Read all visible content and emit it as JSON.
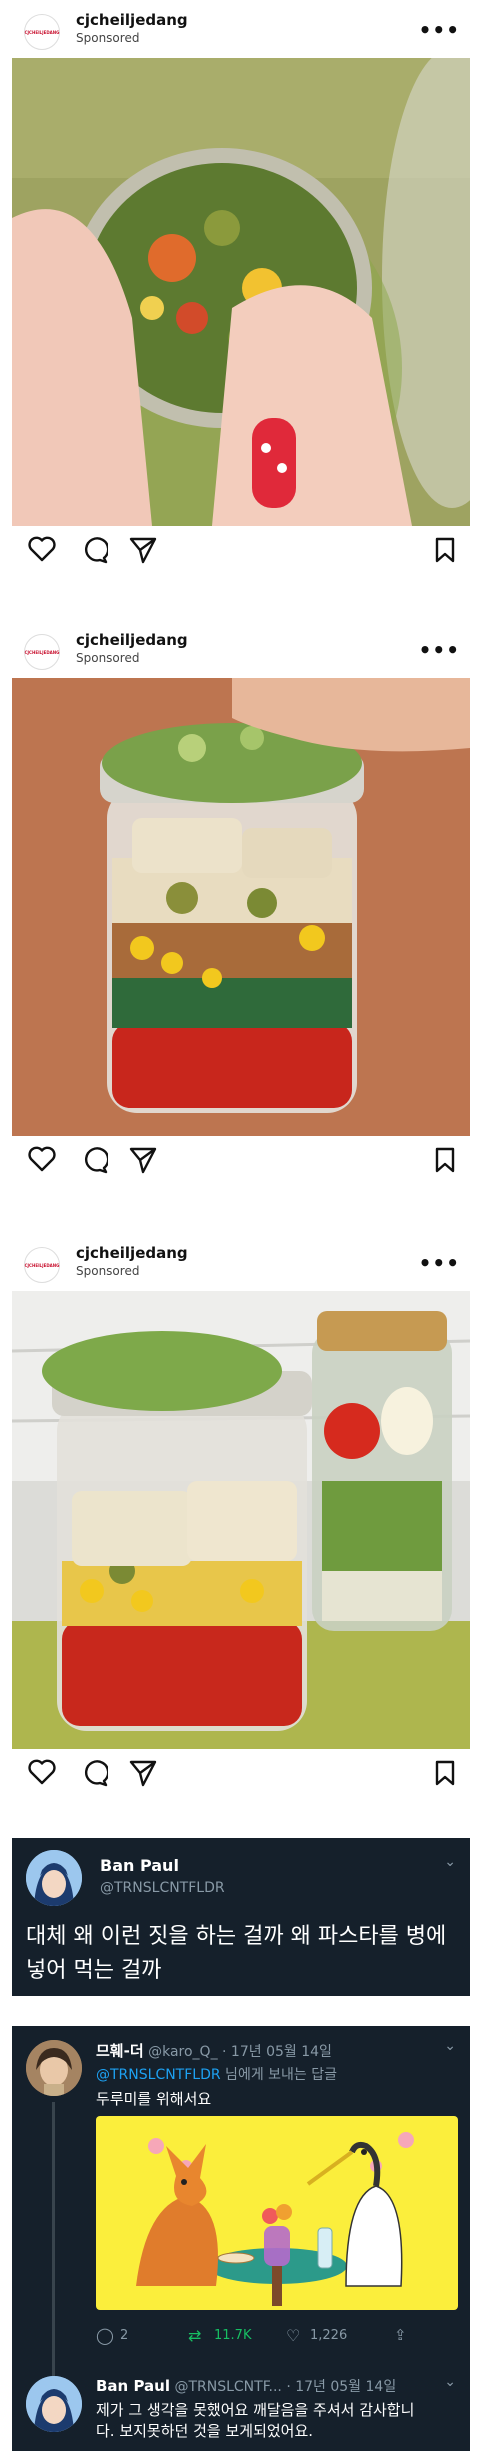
{
  "posts": [
    {
      "username": "cjcheiljedang",
      "sponsored": "Sponsored",
      "logo_text": "CJCHEILJEDANG"
    },
    {
      "username": "cjcheiljedang",
      "sponsored": "Sponsored",
      "logo_text": "CJCHEILJEDANG"
    },
    {
      "username": "cjcheiljedang",
      "sponsored": "Sponsored",
      "logo_text": "CJCHEILJEDANG"
    }
  ],
  "tweet1": {
    "name": "Ban Paul",
    "handle": "@TRNSLCNTFLDR",
    "text": "대체 왜 이런 짓을 하는 걸까 왜 파스타를 병에 넣어 먹는 걸까"
  },
  "tweet2": {
    "name": "므훼-더",
    "handle": "@karo_Q_",
    "date": "· 17년 05월 14일",
    "mention": "@TRNSLCNTFLDR",
    "reply_suffix": " 님에게 보내는 답글",
    "text": "두루미를 위해서요",
    "replies": "2",
    "retweets": "11.7K",
    "likes": "1,226"
  },
  "tweet3": {
    "name": "Ban Paul",
    "handle": "@TRNSLCNTF...",
    "date": "· 17년 05월 14일",
    "text": "제가 그 생각을 못했어요 깨달음을 주셔서 감사합니다. 보지못하던 것을 보게되었어요."
  },
  "colors": {
    "twitter_bg": "#15202b",
    "twitter_blue": "#1da1f2",
    "retweet_green": "#17bf63",
    "muted": "#8899a6"
  }
}
